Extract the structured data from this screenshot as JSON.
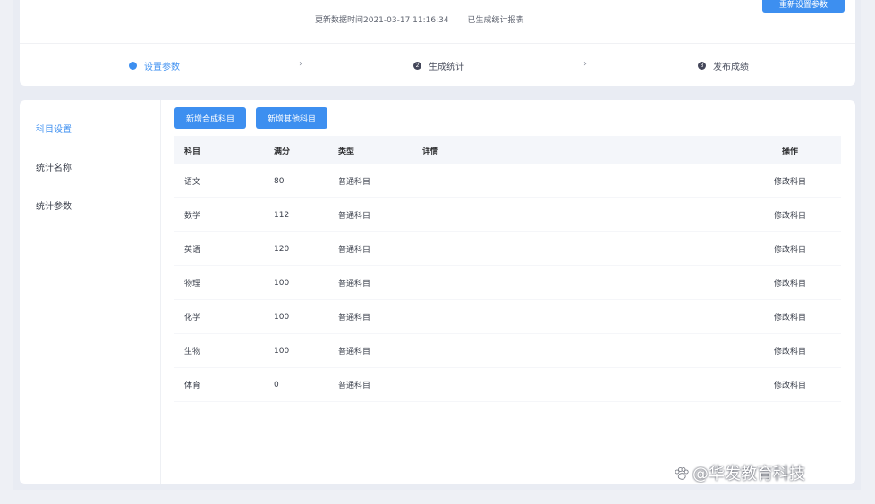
{
  "header": {
    "top_button_label": "重新设置参数",
    "meta_text_1": "更新数据时间2021-03-17 11:16:34",
    "meta_text_2": "已生成统计报表"
  },
  "steps": [
    {
      "label": "设置参数",
      "number": ""
    },
    {
      "label": "生成统计",
      "number": "2"
    },
    {
      "label": "发布成绩",
      "number": "3"
    }
  ],
  "sidebar": {
    "items": [
      {
        "label": "科目设置"
      },
      {
        "label": "统计名称"
      },
      {
        "label": "统计参数"
      }
    ]
  },
  "toolbar": {
    "add_subject_label": "新增合成科目",
    "add_custom_label": "新增其他科目"
  },
  "table": {
    "headers": {
      "subject": "科目",
      "score": "满分",
      "type": "类型",
      "detail": "详情",
      "action": "操作"
    },
    "rows": [
      {
        "subject": "语文",
        "score": "80",
        "type": "普通科目",
        "detail": "",
        "action": "修改科目"
      },
      {
        "subject": "数学",
        "score": "112",
        "type": "普通科目",
        "detail": "",
        "action": "修改科目"
      },
      {
        "subject": "英语",
        "score": "120",
        "type": "普通科目",
        "detail": "",
        "action": "修改科目"
      },
      {
        "subject": "物理",
        "score": "100",
        "type": "普通科目",
        "detail": "",
        "action": "修改科目"
      },
      {
        "subject": "化学",
        "score": "100",
        "type": "普通科目",
        "detail": "",
        "action": "修改科目"
      },
      {
        "subject": "生物",
        "score": "100",
        "type": "普通科目",
        "detail": "",
        "action": "修改科目"
      },
      {
        "subject": "体育",
        "score": "0",
        "type": "普通科目",
        "detail": "",
        "action": "修改科目"
      }
    ]
  },
  "watermark": {
    "text": "@华发教育科技",
    "icon": "paw-icon"
  },
  "colors": {
    "accent": "#3d8ff0",
    "background": "#eef0f5"
  }
}
